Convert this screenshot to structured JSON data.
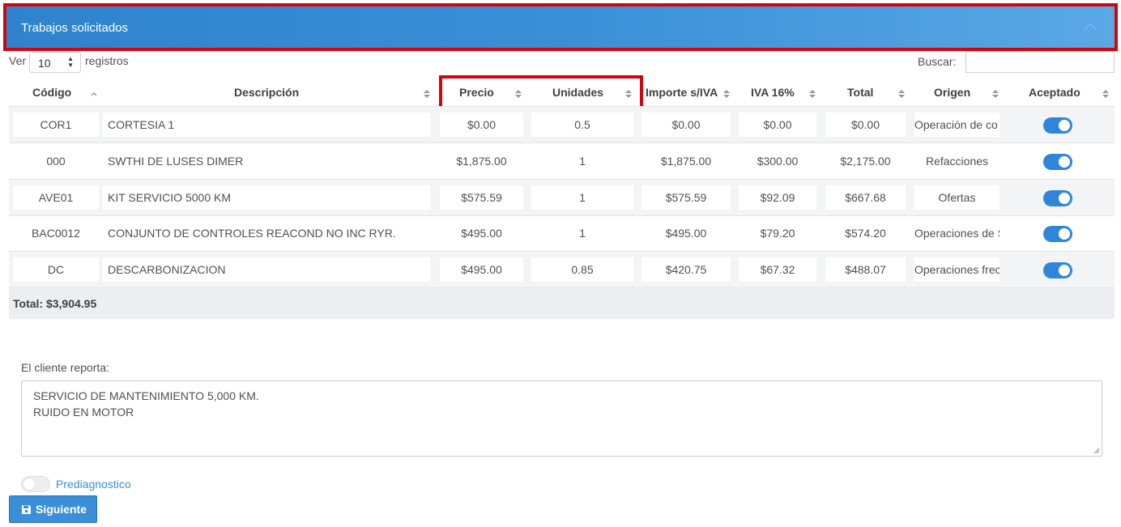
{
  "panel": {
    "title": "Trabajos solicitados",
    "collapse_icon": "chevron-up-icon"
  },
  "controls": {
    "ver_label": "Ver",
    "page_length": "10",
    "registros_label": "registros",
    "buscar_label": "Buscar:",
    "buscar_value": ""
  },
  "table": {
    "headers": {
      "codigo": "Código",
      "descripcion": "Descripción",
      "precio": "Precio",
      "unidades": "Unidades",
      "importe": "Importe s/IVA",
      "iva": "IVA 16%",
      "total": "Total",
      "origen": "Origen",
      "aceptado": "Aceptado"
    },
    "rows": [
      {
        "codigo": "COR1",
        "descripcion": "CORTESIA 1",
        "precio": "$0.00",
        "unidades": "0.5",
        "importe": "$0.00",
        "iva": "$0.00",
        "total": "$0.00",
        "origen": "Operación de co",
        "aceptado": true
      },
      {
        "codigo": "000",
        "descripcion": "SWTHI DE LUSES DIMER",
        "precio": "$1,875.00",
        "unidades": "1",
        "importe": "$1,875.00",
        "iva": "$300.00",
        "total": "$2,175.00",
        "origen": "Refacciones",
        "aceptado": true
      },
      {
        "codigo": "AVE01",
        "descripcion": "KIT SERVICIO 5000 KM",
        "precio": "$575.59",
        "unidades": "1",
        "importe": "$575.59",
        "iva": "$92.09",
        "total": "$667.68",
        "origen": "Ofertas",
        "aceptado": true
      },
      {
        "codigo": "BAC0012",
        "descripcion": "CONJUNTO DE CONTROLES REACOND NO INC RYR.",
        "precio": "$495.00",
        "unidades": "1",
        "importe": "$495.00",
        "iva": "$79.20",
        "total": "$574.20",
        "origen": "Operaciones de S",
        "aceptado": true
      },
      {
        "codigo": "DC",
        "descripcion": "DESCARBONIZACION",
        "precio": "$495.00",
        "unidades": "0.85",
        "importe": "$420.75",
        "iva": "$67.32",
        "total": "$488.07",
        "origen": "Operaciones frec",
        "aceptado": true
      }
    ],
    "total_label": "Total: $3,904.95"
  },
  "report": {
    "label": "El cliente reporta:",
    "text": "SERVICIO DE MANTENIMIENTO 5,000 KM.\nRUIDO EN MOTOR"
  },
  "prediagnostico": {
    "label": "Prediagnostico",
    "enabled": false
  },
  "next_button": {
    "label": "Siguiente",
    "icon": "save-icon"
  },
  "colors": {
    "header_start": "#2f83cd",
    "header_end": "#5aa8e6",
    "highlight": "#d3040e",
    "toggle_on": "#2f86d9",
    "link": "#3a8fd7"
  }
}
